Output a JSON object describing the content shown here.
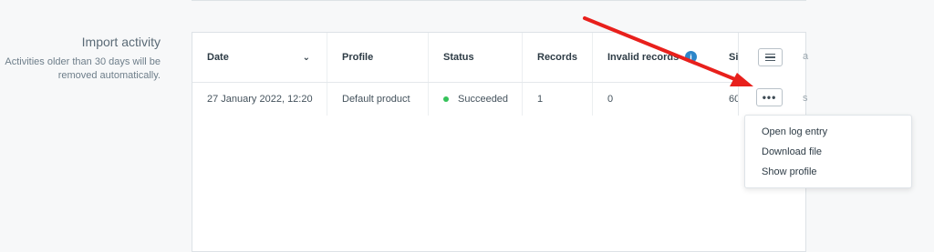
{
  "section": {
    "title": "Import activity",
    "description": "Activities older than 30 days will be removed automatically."
  },
  "table": {
    "columns": [
      "Date",
      "Profile",
      "Status",
      "Records",
      "Invalid records",
      "Si"
    ],
    "row": {
      "date": "27 January 2022, 12:20",
      "profile": "Default product",
      "status": "Succeeded",
      "records": "1",
      "invalid_records": "0",
      "size": "60"
    }
  },
  "dropdown": {
    "items": [
      "Open log entry",
      "Download file",
      "Show profile"
    ]
  },
  "icons": {
    "sort": "chevron-down-icon",
    "info": "info-icon",
    "columns": "hamburger-icon",
    "more": "ellipsis-icon",
    "annotation": "red-arrow"
  },
  "colors": {
    "success": "#35c25a",
    "info": "#2d86c9",
    "annotation": "#e8201c"
  }
}
